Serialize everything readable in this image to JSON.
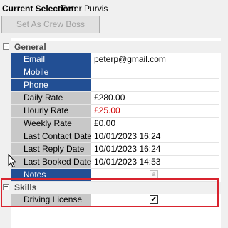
{
  "header": {
    "selection_label": "Current Selection:",
    "selection_value": "Peter Purvis",
    "crew_boss_button": "Set As Crew Boss"
  },
  "categories": {
    "general": {
      "toggle": "−",
      "label": "General"
    },
    "skills": {
      "toggle": "−",
      "label": "Skills"
    }
  },
  "general_rows": [
    {
      "label": "Email",
      "value": "peterp@gmail.com"
    },
    {
      "label": "Mobile",
      "value": ""
    },
    {
      "label": "Phone",
      "value": ""
    },
    {
      "label": "Daily Rate",
      "value": "£280.00"
    },
    {
      "label": "Hourly Rate",
      "value": "£25.00"
    },
    {
      "label": "Weekly Rate",
      "value": "£0.00"
    },
    {
      "label": "Last Contact Date",
      "value": "10/01/2023 16:24"
    },
    {
      "label": "Last Reply Date",
      "value": "10/01/2023 16:24"
    },
    {
      "label": "Last Booked Date",
      "value": "10/01/2023 14:53"
    },
    {
      "label": "Notes",
      "value": ""
    }
  ],
  "notes_icon_glyph": "a",
  "skills_rows": [
    {
      "label": "Driving License",
      "checked": true,
      "check_glyph": "✔"
    }
  ],
  "colors": {
    "key_field_bg": "#224f94",
    "label_bg": "#c8c8c8",
    "hourly_rate_text": "#d00000",
    "highlight_border": "#d9232e"
  },
  "icons": {
    "collapse": "collapse-icon",
    "notes": "notes-editor-icon",
    "cursor": "mouse-pointer-icon"
  }
}
